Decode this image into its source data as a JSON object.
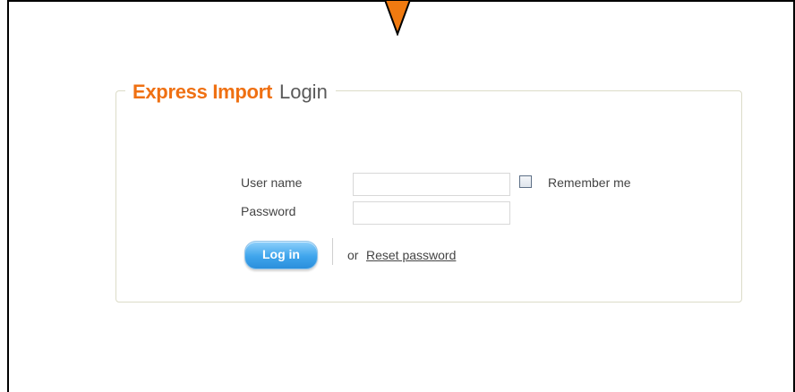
{
  "header": {
    "brand": "Express Import",
    "title": "Login"
  },
  "form": {
    "username_label": "User name",
    "username_value": "",
    "password_label": "Password",
    "password_value": "",
    "remember_label": "Remember me",
    "remember_checked": false,
    "login_button": "Log in",
    "or_text": "or",
    "reset_link": "Reset password"
  },
  "colors": {
    "brand": "#ef7012",
    "button": "#3fa5ec",
    "pointer": "#f07a10"
  },
  "icons": {
    "pointer": "down-arrow-pointer-icon"
  }
}
